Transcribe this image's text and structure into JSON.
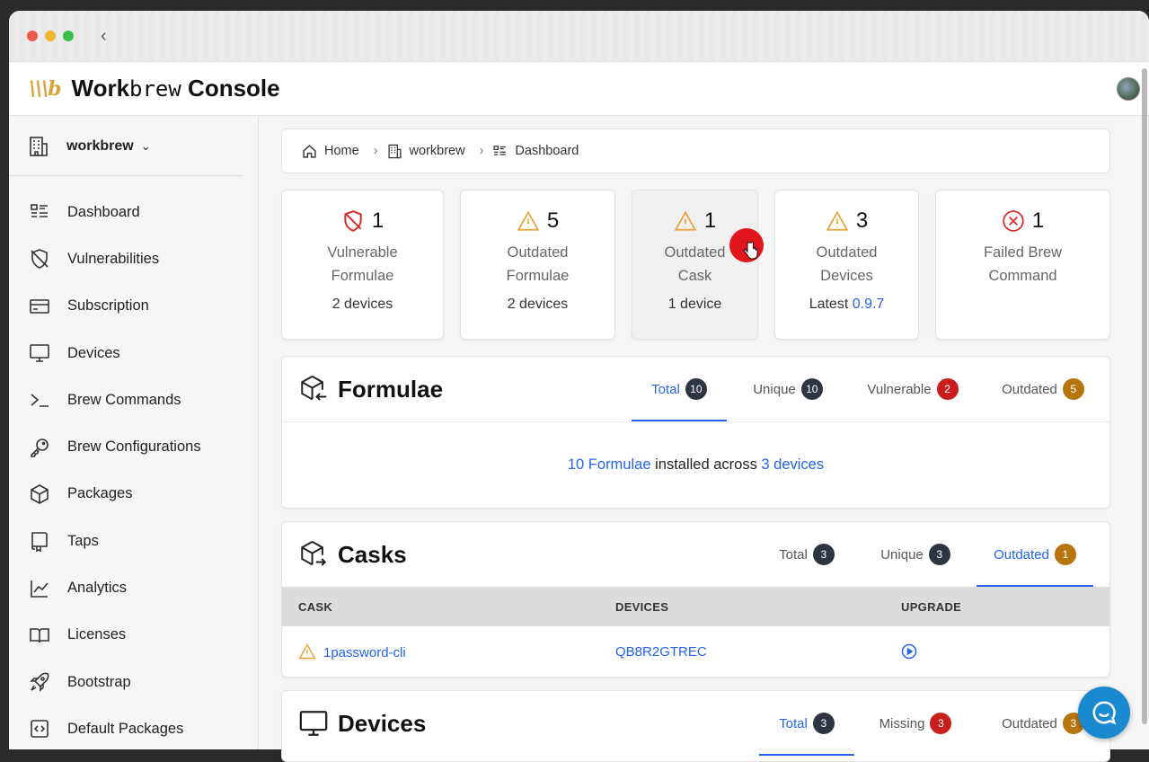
{
  "brand": {
    "prefix": "Work",
    "mono": "brew",
    "suffix": " Console"
  },
  "sidebar": {
    "org": "workbrew",
    "items": [
      {
        "label": "Dashboard",
        "icon": "dashboard-icon"
      },
      {
        "label": "Vulnerabilities",
        "icon": "shield-off-icon"
      },
      {
        "label": "Subscription",
        "icon": "credit-card-icon"
      },
      {
        "label": "Devices",
        "icon": "monitor-icon"
      },
      {
        "label": "Brew Commands",
        "icon": "terminal-icon"
      },
      {
        "label": "Brew Configurations",
        "icon": "key-icon"
      },
      {
        "label": "Packages",
        "icon": "package-icon"
      },
      {
        "label": "Taps",
        "icon": "tap-icon"
      },
      {
        "label": "Analytics",
        "icon": "chart-line-icon"
      },
      {
        "label": "Licenses",
        "icon": "book-icon"
      },
      {
        "label": "Bootstrap",
        "icon": "rocket-icon"
      },
      {
        "label": "Default Packages",
        "icon": "code-file-icon"
      }
    ]
  },
  "breadcrumb": {
    "home": "Home",
    "org": "workbrew",
    "page": "Dashboard"
  },
  "stats": [
    {
      "count": "1",
      "label1": "Vulnerable",
      "label2": "Formulae",
      "sub": "2 devices"
    },
    {
      "count": "5",
      "label1": "Outdated",
      "label2": "Formulae",
      "sub": "2 devices"
    },
    {
      "count": "1",
      "label1": "Outdated",
      "label2": "Cask",
      "sub": "1 device"
    },
    {
      "count": "3",
      "label1": "Outdated",
      "label2": "Devices",
      "sub_prefix": "Latest ",
      "sub_link": "0.9.7"
    },
    {
      "count": "1",
      "label1": "Failed Brew",
      "label2": "Command"
    }
  ],
  "formulae": {
    "title": "Formulae",
    "tabs": [
      {
        "label": "Total",
        "count": "10"
      },
      {
        "label": "Unique",
        "count": "10"
      },
      {
        "label": "Vulnerable",
        "count": "2"
      },
      {
        "label": "Outdated",
        "count": "5"
      }
    ],
    "summary": {
      "link1": "10 Formulae",
      "middle": " installed across ",
      "link2": "3 devices"
    }
  },
  "casks": {
    "title": "Casks",
    "tabs": [
      {
        "label": "Total",
        "count": "3"
      },
      {
        "label": "Unique",
        "count": "3"
      },
      {
        "label": "Outdated",
        "count": "1"
      }
    ],
    "columns": [
      "CASK",
      "DEVICES",
      "UPGRADE"
    ],
    "rows": [
      {
        "cask": "1password-cli",
        "devices": "QB8R2GTREC"
      }
    ]
  },
  "devices": {
    "title": "Devices",
    "tabs": [
      {
        "label": "Total",
        "count": "3"
      },
      {
        "label": "Missing",
        "count": "3"
      },
      {
        "label": "Outdated",
        "count": "3"
      }
    ]
  },
  "colors": {
    "accent": "#2563eb",
    "warning": "#e8a33b",
    "danger": "#d42b2b",
    "brand": "#d7a43a"
  }
}
